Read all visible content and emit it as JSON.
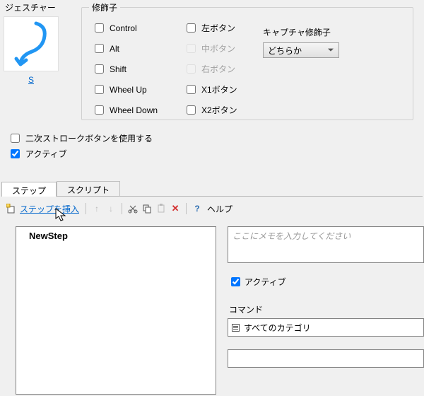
{
  "gesture": {
    "label": "ジェスチャー",
    "letter": "S"
  },
  "modifiers": {
    "legend": "修飾子",
    "col1": [
      {
        "label": "Control",
        "checked": false,
        "disabled": false
      },
      {
        "label": "Alt",
        "checked": false,
        "disabled": false
      },
      {
        "label": "Shift",
        "checked": false,
        "disabled": false
      },
      {
        "label": "Wheel Up",
        "checked": false,
        "disabled": false
      },
      {
        "label": "Wheel Down",
        "checked": false,
        "disabled": false
      }
    ],
    "col2": [
      {
        "label": "左ボタン",
        "checked": false,
        "disabled": false
      },
      {
        "label": "中ボタン",
        "checked": false,
        "disabled": true
      },
      {
        "label": "右ボタン",
        "checked": false,
        "disabled": true
      },
      {
        "label": "X1ボタン",
        "checked": false,
        "disabled": false
      },
      {
        "label": "X2ボタン",
        "checked": false,
        "disabled": false
      }
    ],
    "capture_label": "キャプチャ修飾子",
    "capture_value": "どちらか"
  },
  "secondary": {
    "use_stroke": {
      "label": "二次ストロークボタンを使用する",
      "checked": false
    },
    "active": {
      "label": "アクティブ",
      "checked": true
    }
  },
  "tabs": {
    "step": "ステップ",
    "script": "スクリプト"
  },
  "toolbar": {
    "insert_step": "ステップを挿入",
    "help": "ヘルプ"
  },
  "steps": {
    "items": [
      {
        "name": "NewStep"
      }
    ]
  },
  "right": {
    "memo_placeholder": "ここにメモを入力してください",
    "active_label": "アクティブ",
    "active_checked": true,
    "command_label": "コマンド",
    "command_value": "すべてのカテゴリ"
  }
}
